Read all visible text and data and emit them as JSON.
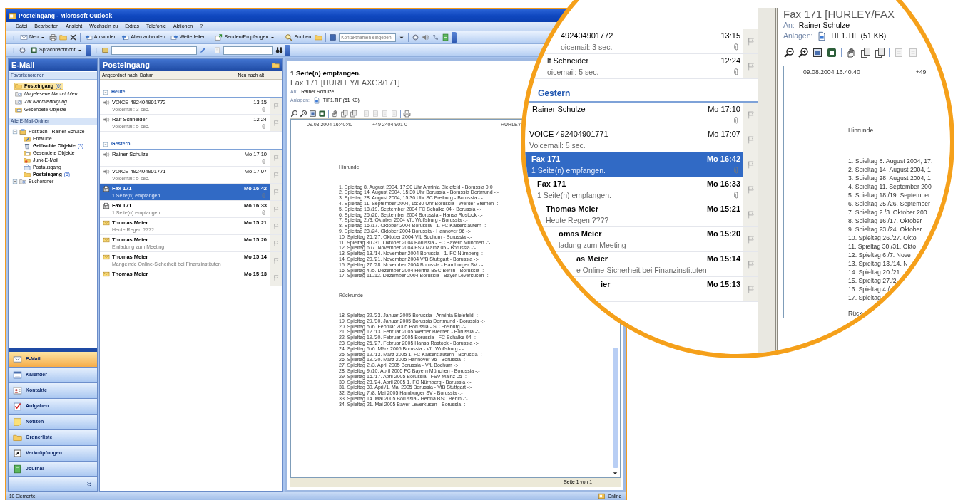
{
  "window": {
    "title": "Posteingang - Microsoft Outlook"
  },
  "menu": [
    "Datei",
    "Bearbeiten",
    "Ansicht",
    "Wechseln zu",
    "Extras",
    "Telefonie",
    "Aktionen",
    "?"
  ],
  "toolbar": {
    "new": "Neu",
    "reply": "Antworten",
    "reply_all": "Allen antworten",
    "forward": "Weiterleiten",
    "send_receive": "Senden/Empfangen",
    "find": "Suchen",
    "contact_search": {
      "placeholder": "Kontaktnamen eingeben"
    },
    "voice_message": "Sprachnachricht"
  },
  "nav": {
    "title": "E-Mail",
    "favorites_title": "Favoritenordner",
    "favorites": [
      {
        "label": "Posteingang",
        "count": "(6)",
        "kind": "inbox",
        "unread": true,
        "selected": true
      },
      {
        "label": "Ungelesene Nachrichten",
        "kind": "searchfolder",
        "unread": false,
        "selected": false
      },
      {
        "label": "Zur Nachverfolgung",
        "kind": "searchfolder",
        "unread": false,
        "selected": false
      },
      {
        "label": "Gesendete Objekte",
        "kind": "sent",
        "unread": false,
        "selected": false
      }
    ],
    "folders_title": "Alle E-Mail-Ordner",
    "folders": [
      {
        "label": "Postfach - Rainer Schulze",
        "kind": "mailbox",
        "expanded": true,
        "unread": false,
        "selected": false,
        "children": [
          {
            "label": "Entwürfe",
            "kind": "drafts",
            "unread": false,
            "selected": false
          },
          {
            "label": "Gelöschte Objekte",
            "count": "(3)",
            "kind": "deleted",
            "unread": true,
            "selected": false
          },
          {
            "label": "Gesendete Objekte",
            "kind": "sent",
            "unread": false,
            "selected": false
          },
          {
            "label": "Junk-E-Mail",
            "kind": "junk",
            "unread": false,
            "selected": false
          },
          {
            "label": "Postausgang",
            "kind": "outbox",
            "unread": false,
            "selected": false
          },
          {
            "label": "Posteingang",
            "count": "(6)",
            "kind": "inbox",
            "unread": true,
            "selected": false
          }
        ]
      },
      {
        "label": "Suchordner",
        "kind": "searchroot",
        "expanded": false,
        "unread": false,
        "selected": false
      }
    ],
    "buttons": [
      {
        "label": "E-Mail",
        "kind": "mail",
        "selected": true
      },
      {
        "label": "Kalender",
        "kind": "calendar",
        "selected": false
      },
      {
        "label": "Kontakte",
        "kind": "contacts",
        "selected": false
      },
      {
        "label": "Aufgaben",
        "kind": "tasks",
        "selected": false
      },
      {
        "label": "Notizen",
        "kind": "notes",
        "selected": false
      },
      {
        "label": "Ordnerliste",
        "kind": "folders",
        "selected": false
      },
      {
        "label": "Verknüpfungen",
        "kind": "shortcuts",
        "selected": false
      },
      {
        "label": "Journal",
        "kind": "journal",
        "selected": false
      }
    ]
  },
  "list": {
    "title": "Posteingang",
    "arranged_by": "Angeordnet nach: Datum",
    "sort_order": "Neu nach alt",
    "groups": [
      {
        "label": "Heute",
        "expanded": true,
        "items": [
          {
            "kind": "voice",
            "sender": "VOICE 492404901772",
            "time": "13:15",
            "preview": "Voicemail: 3 sec.",
            "unread": false,
            "attachment": true,
            "selected": false
          },
          {
            "kind": "voice",
            "sender": "Ralf Schneider",
            "time": "12:24",
            "preview": "Voicemail: 5 sec.",
            "unread": false,
            "attachment": true,
            "selected": false
          }
        ]
      },
      {
        "label": "Gestern",
        "expanded": true,
        "items": [
          {
            "kind": "voice",
            "sender": "Rainer Schulze",
            "time": "Mo 17:10",
            "unread": false,
            "attachment": true,
            "selected": false
          },
          {
            "kind": "voice",
            "sender": "VOICE 492404901771",
            "time": "Mo 17:07",
            "preview": "Voicemail: 5 sec.",
            "unread": false,
            "attachment": false,
            "selected": false
          },
          {
            "kind": "fax",
            "sender": "Fax 171",
            "time": "Mo 16:42",
            "preview": "1 Seite(n) empfangen.",
            "unread": true,
            "attachment": true,
            "selected": true
          },
          {
            "kind": "fax",
            "sender": "Fax 171",
            "time": "Mo 16:33",
            "preview": "1 Seite(n) empfangen.",
            "unread": true,
            "attachment": true,
            "selected": false
          },
          {
            "kind": "mail",
            "sender": "Thomas Meier",
            "time": "Mo 15:21",
            "preview": "Heute Regen ????",
            "unread": true,
            "attachment": false,
            "selected": false
          },
          {
            "kind": "mail",
            "sender": "Thomas Meier",
            "time": "Mo 15:20",
            "preview": "Einladung zum Meeting",
            "unread": true,
            "attachment": false,
            "selected": false
          },
          {
            "kind": "mail",
            "sender": "Thomas Meier",
            "time": "Mo 15:14",
            "preview": "Mangelnde Online-Sicherheit bei Finanzinstituten",
            "unread": true,
            "attachment": false,
            "selected": false
          },
          {
            "kind": "mail",
            "sender": "Thomas Meier",
            "time": "Mo 15:13",
            "unread": true,
            "attachment": false,
            "selected": false
          }
        ]
      }
    ]
  },
  "reading": {
    "subject": "1 Seite(n) empfangen.",
    "from": "Fax 171 [HURLEY/FAXG3/171]",
    "to_label": "An:",
    "to": "Rainer Schulze",
    "attachments_label": "Anlagen:",
    "attachment": "TIF1.TIF (51 KB)",
    "fax": {
      "header": [
        "09.08.2004 16:40:40",
        "+49 2404 901 0",
        "HURLEY"
      ],
      "sections": [
        {
          "title": "Hinrunde",
          "lines": [
            "1. Spieltag 8. August 2004, 17:30 Uhr Arminia Bielefeld - Borussia 0:0",
            "2. Spieltag 14. August 2004, 15:30 Uhr Borussia - Borussia Dortmund -:-",
            "3. Spieltag 28. August 2004, 15:30 Uhr SC Freiburg - Borussia -:-",
            "4. Spieltag 11. September 2004, 15:30 Uhr Borussia - Werder Bremen -:-",
            "5. Spieltag 18./19. September 2004 FC Schalke 04 - Borussia -:-",
            "6. Spieltag 25./26. September 2004 Borussia - Hansa Rostock -:-",
            "7. Spieltag 2./3. Oktober 2004 VfL Wolfsburg - Borussia -:-",
            "8. Spieltag 16./17. Oktober 2004 Borussia - 1. FC Kaiserslautern -:-",
            "9. Spieltag 23./24. Oktober 2004 Borussia - Hannover 96 -:-",
            "10. Spieltag 26./27. Oktober 2004 VfL Bochum - Borussia -:-",
            "11. Spieltag 30./31. Oktober 2004 Borussia - FC Bayern München -:-",
            "12. Spieltag 6./7. November 2004 FSV Mainz 05 - Borussia -:-",
            "13. Spieltag 13./14. November 2004 Borussia - 1. FC Nürnberg -:-",
            "14. Spieltag 20./21. November 2004 VfB Stuttgart - Borussia -:-",
            "15. Spieltag 27./28. November 2004 Borussia - Hamburger SV -:-",
            "16. Spieltag 4./5. Dezember 2004 Hertha BSC Berlin - Borussia -:-",
            "17. Spieltag 11./12. Dezember 2004 Borussia - Bayer Leverkusen -:-"
          ]
        },
        {
          "title": "Rückrunde",
          "lines": [
            "18. Spieltag 22./23. Januar 2005 Borussia - Arminia Bielefeld -:-",
            "19. Spieltag 29./30. Januar 2005 Borussia Dortmund - Borussia -:-",
            "20. Spieltag 5./6. Februar 2005 Borussia - SC Freiburg -:-",
            "21. Spieltag 12./13. Februar 2005 Werder Bremen - Borussia -:-",
            "22. Spieltag 19./20. Februar 2005 Borussia - FC Schalke 04 -:-",
            "23. Spieltag 26./27. Februar 2005 Hansa Rostock - Borussia -:-",
            "24. Spieltag 5./6. März 2005 Borussia - VfL Wolfsburg -:-",
            "25. Spieltag 12./13. März 2005 1. FC Kaiserslautern - Borussia -:-",
            "26. Spieltag 19./20. März 2005 Hannover 96 - Borussia -:-",
            "27. Spieltag 2./3. April 2005 Borussia - VfL Bochum -:-",
            "28. Spieltag 9./10. April 2005 FC Bayern München - Borussia -:-",
            "29. Spieltag 16./17. April 2005 Borussia - FSV Mainz 05 -:-",
            "30. Spieltag 23./24. April 2005 1. FC Nürnberg - Borussia -:-",
            "31. Spieltag 30. April/1. Mai 2005 Borussia - VfB Stuttgart -:-",
            "32. Spieltag 7./8. Mai 2005 Hamburger SV - Borussia -:-",
            "33. Spieltag 14. Mai 2005 Borussia - Hertha BSC Berlin -:-",
            "34. Spieltag 21. Mai 2005 Bayer Leverkusen - Borussia -:-"
          ]
        }
      ]
    },
    "page_status": "Seite 1 von 1"
  },
  "status_bar": {
    "items": "10 Elemente",
    "connection": "Online"
  },
  "magnifier": {
    "list": [
      {
        "kind": "row",
        "sender": "492404901772",
        "time": "13:15",
        "preview": "oicemail: 3 sec.",
        "unread": false,
        "attachment": true,
        "selected": false
      },
      {
        "kind": "row",
        "sender": "lf Schneider",
        "time": "12:24",
        "preview": "oicemail: 5 sec.",
        "unread": false,
        "attachment": true,
        "selected": false
      },
      {
        "kind": "group",
        "label": "Gestern"
      },
      {
        "kind": "row",
        "sender": "Rainer Schulze",
        "time": "Mo 17:10",
        "unread": false,
        "attachment": true,
        "selected": false
      },
      {
        "kind": "row",
        "sender": "VOICE 492404901771",
        "time": "Mo 17:07",
        "preview": "Voicemail: 5 sec.",
        "unread": false,
        "attachment": false,
        "selected": false
      },
      {
        "kind": "row",
        "sender": "Fax 171",
        "time": "Mo 16:42",
        "preview": "1 Seite(n) empfangen.",
        "unread": true,
        "attachment": true,
        "selected": true
      },
      {
        "kind": "row",
        "sender": "Fax 171",
        "time": "Mo 16:33",
        "preview": "1 Seite(n) empfangen.",
        "unread": true,
        "attachment": true,
        "selected": false
      },
      {
        "kind": "row",
        "sender": "Thomas Meier",
        "time": "Mo 15:21",
        "preview": "Heute Regen ????",
        "unread": true,
        "attachment": false,
        "selected": false
      },
      {
        "kind": "row",
        "sender": "omas Meier",
        "time": "Mo 15:20",
        "preview": "ladung zum Meeting",
        "unread": true,
        "attachment": false,
        "selected": false
      },
      {
        "kind": "row",
        "sender": "as Meier",
        "time": "Mo 15:14",
        "preview": "e Online-Sicherheit bei Finanzinstituten",
        "unread": true,
        "attachment": false,
        "selected": false
      },
      {
        "kind": "row",
        "sender": "ier",
        "time": "Mo 15:13",
        "unread": true,
        "attachment": false,
        "selected": false
      }
    ],
    "pane": {
      "from": "Fax 171 [HURLEY/FAX",
      "to_label": "An:",
      "to": "Rainer Schulze",
      "attachments_label": "Anlagen:",
      "attachment": "TIF1.TIF (51 KB)",
      "fax_header": [
        "09.08.2004 16:40:40",
        "+49"
      ],
      "section": "Hinrunde",
      "lines": [
        "1. Spieltag 8. August 2004, 17.",
        "2. Spieltag 14. August 2004, 1",
        "3. Spieltag 28. August 2004, 1",
        "4. Spieltag 11. September 200",
        "5. Spieltag 18./19. September",
        "6. Spieltag 25./26. September",
        "7. Spieltag 2./3. Oktober 200",
        "8. Spieltag 16./17. Oktober",
        "9. Spieltag 23./24. Oktober",
        "10. Spieltag 26./27. Okto",
        "11. Spieltag 30./31. Okto",
        "12. Spieltag 6./7. Nove",
        "13. Spieltag 13./14. N",
        "14. Spieltag 20./21.",
        "15. Spieltag 27./2",
        "16. Spieltag 4./",
        "17. Spieltag"
      ],
      "next_section": "Rück"
    }
  }
}
